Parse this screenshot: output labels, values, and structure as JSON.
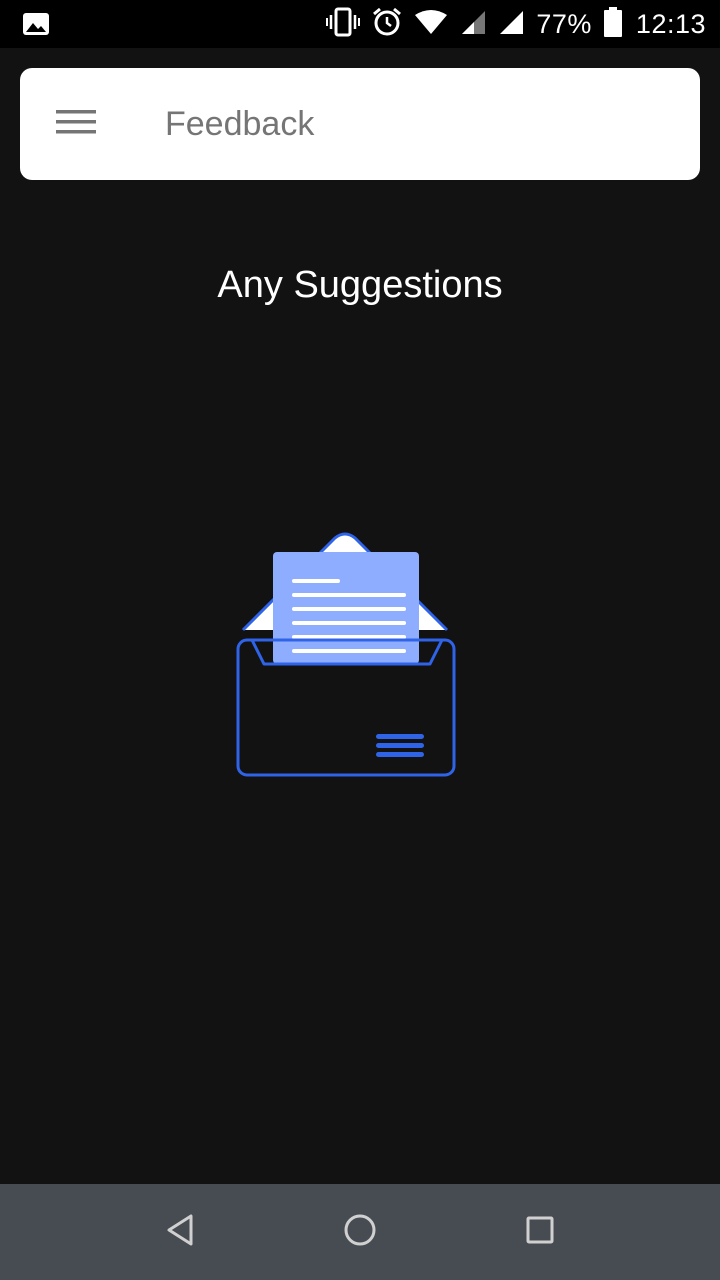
{
  "status_bar": {
    "left_icon": "gallery-icon",
    "icons": [
      "vibrate-icon",
      "alarm-icon",
      "wifi-icon",
      "signal-icon",
      "signal-icon"
    ],
    "battery_percent": "77%",
    "battery_icon": "battery-icon",
    "time": "12:13"
  },
  "app_bar": {
    "menu_icon": "hamburger-menu-icon",
    "title": "Feedback"
  },
  "main": {
    "heading": "Any Suggestions",
    "illustration": "open-envelope-with-letter-icon"
  },
  "nav_bar": {
    "back_icon": "back-triangle-icon",
    "home_icon": "home-circle-icon",
    "recents_icon": "recents-square-icon"
  },
  "colors": {
    "background": "#121212",
    "accent_blue": "#2f63e8",
    "letter_blue": "#8fadff",
    "nav_bar": "#474c52",
    "app_bar": "#ffffff",
    "title_text": "#757575"
  }
}
